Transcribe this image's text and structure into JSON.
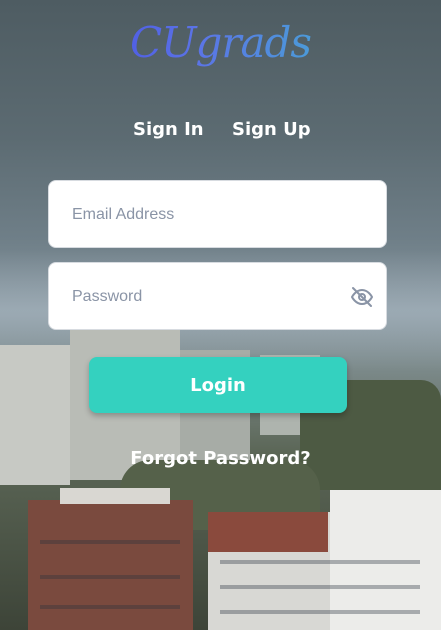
{
  "brand": {
    "logo_text": "CUgrads"
  },
  "tabs": {
    "signin": "Sign In",
    "signup": "Sign Up"
  },
  "form": {
    "email_placeholder": "Email Address",
    "password_placeholder": "Password",
    "login_label": "Login",
    "forgot_label": "Forgot Password?"
  },
  "icons": {
    "password_toggle": "eye-slash-icon"
  },
  "colors": {
    "primary": "#34d1bf",
    "logo_start": "#3d3ae0",
    "logo_end": "#39c6c9"
  }
}
